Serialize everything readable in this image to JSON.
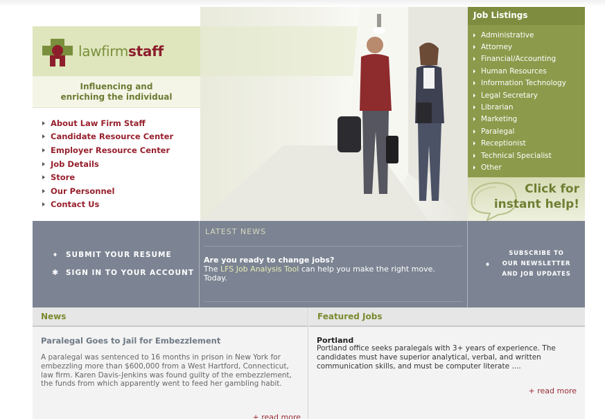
{
  "brand": {
    "logo_plain": "lawfirm",
    "logo_bold": "staff",
    "tagline_line1": "Influencing and",
    "tagline_line2": "enriching the individual"
  },
  "colors": {
    "olive": "#8c9a4b",
    "burgundy": "#97202d",
    "slate": "#7c8493"
  },
  "left_nav": [
    {
      "label": "About Law Firm Staff"
    },
    {
      "label": "Candidate Resource Center"
    },
    {
      "label": "Employer Resource Center"
    },
    {
      "label": "Job Details"
    },
    {
      "label": "Store"
    },
    {
      "label": "Our Personnel"
    },
    {
      "label": "Contact Us"
    }
  ],
  "job_listings": {
    "title": "Job Listings",
    "items": [
      "Administrative",
      "Attorney",
      "Financial/Accounting",
      "Human Resources",
      "Information Technology",
      "Legal Secretary",
      "Librarian",
      "Marketing",
      "Paralegal",
      "Receptionist",
      "Technical Specialist",
      "Other"
    ]
  },
  "help": {
    "line1": "Click for",
    "line2": "instant help!"
  },
  "band": {
    "submit_resume": "SUBMIT YOUR RESUME",
    "sign_in": "SIGN IN TO YOUR ACCOUNT",
    "latest_news": "LATEST NEWS",
    "question": "Are you ready to change jobs?",
    "answer_pre": "The ",
    "answer_link": "LFS Job Analysis Tool",
    "answer_post": " can help you make the right move. Today.",
    "subscribe_line1": "SUBSCRIBE TO",
    "subscribe_line2": "OUR NEWSLETTER",
    "subscribe_line3": "AND JOB UPDATES"
  },
  "news": {
    "heading": "News",
    "title": "Paralegal Goes to Jail for Embezzlement",
    "body": "A paralegal was sentenced to 16 months in prison in New York for embezzling more than $600,000 from a West Hartford, Connecticut, law firm. Karen Davis-Jenkins was found guilty of the embezzlement, the funds from which apparently went to feed her gambling habit.",
    "read_more": "+ read more"
  },
  "featured": {
    "heading": "Featured Jobs",
    "title": "Portland",
    "body": "Portland office seeks paralegals with 3+ years of experience. The candidates must have superior analytical, verbal, and written communication skills, and must be computer literate ....",
    "read_more": "+ read more"
  }
}
